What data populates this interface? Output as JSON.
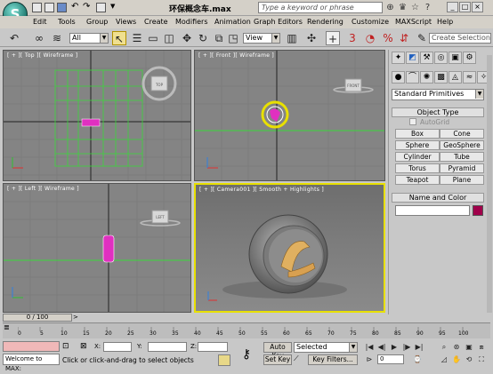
{
  "title": {
    "file_name": "环保概念车.max",
    "search_placeholder": "Type a keyword or phrase"
  },
  "menu": [
    "Edit",
    "Tools",
    "Group",
    "Views",
    "Create",
    "Modifiers",
    "Animation",
    "Graph Editors",
    "Rendering",
    "Customize",
    "MAXScript",
    "Help"
  ],
  "toolbar": {
    "selection_filter": "All",
    "ref_coord": "View",
    "named_selection": "Create Selection"
  },
  "viewports": {
    "top": "[ + ][ Top ][ Wireframe ]",
    "front": "[ + ][ Front ][ Wireframe ]",
    "left": "[ + ][ Left ][ Wireframe ]",
    "camera": "[ + ][ Camera001 ][ Smooth + Highlights ]",
    "cube_top": "TOP",
    "cube_front": "FRONT",
    "cube_left": "LEFT"
  },
  "command_panel": {
    "category": "Standard Primitives",
    "object_type_title": "Object Type",
    "autogrid": "AutoGrid",
    "primitives": [
      "Box",
      "Cone",
      "Sphere",
      "GeoSphere",
      "Cylinder",
      "Tube",
      "Torus",
      "Pyramid",
      "Teapot",
      "Plane"
    ],
    "name_color_title": "Name and Color"
  },
  "timeline": {
    "frame_counter": "0 / 100",
    "ticks": [
      "0",
      "5",
      "10",
      "15",
      "20",
      "25",
      "30",
      "35",
      "40",
      "45",
      "50",
      "55",
      "60",
      "65",
      "70",
      "75",
      "80",
      "85",
      "90",
      "95",
      "100"
    ]
  },
  "status": {
    "welcome": "Welcome to MAX:",
    "prompt": "Click or click-and-drag to select objects",
    "x_label": "X:",
    "y_label": "Y:",
    "z_label": "Z:",
    "auto_key": "Auto Key",
    "set_key": "Set Key",
    "key_mode": "Selected",
    "key_filters": "Key Filters...",
    "frame_value": "0"
  },
  "colors": {
    "grid_green": "#3ad83a",
    "selection_yellow": "#e8e000",
    "object_pink": "#e030c0",
    "name_swatch": "#a0004a"
  }
}
